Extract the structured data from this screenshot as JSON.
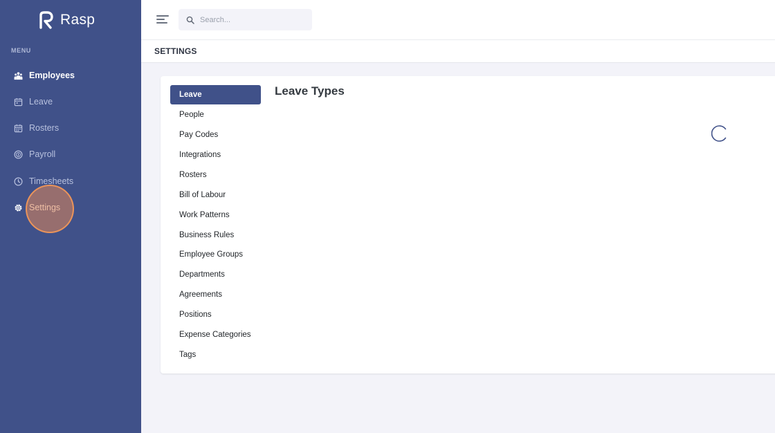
{
  "brand": {
    "name": "Rasp"
  },
  "sidebar": {
    "menu_title": "MENU",
    "items": [
      {
        "label": "Employees",
        "icon": "employees-icon"
      },
      {
        "label": "Leave",
        "icon": "calendar-icon"
      },
      {
        "label": "Rosters",
        "icon": "calendar-grid-icon"
      },
      {
        "label": "Payroll",
        "icon": "dollar-circle-icon"
      },
      {
        "label": "Timesheets",
        "icon": "clock-icon"
      },
      {
        "label": "Settings",
        "icon": "gear-icon"
      }
    ]
  },
  "topbar": {
    "search_placeholder": "Search..."
  },
  "page": {
    "title": "SETTINGS"
  },
  "settings_nav": {
    "items": [
      "Leave",
      "People",
      "Pay Codes",
      "Integrations",
      "Rosters",
      "Bill of Labour",
      "Work Patterns",
      "Business Rules",
      "Employee Groups",
      "Departments",
      "Agreements",
      "Positions",
      "Expense Categories",
      "Tags"
    ],
    "active": "Leave"
  },
  "content": {
    "section_title": "Leave Types"
  },
  "colors": {
    "sidebar_bg": "#405189",
    "accent": "#405189",
    "page_bg": "#f3f3f9",
    "click_highlight": "#de8758"
  }
}
